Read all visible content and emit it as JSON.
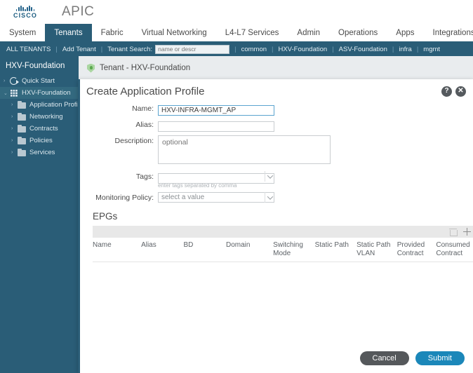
{
  "brand": {
    "logo_name": "cisco-logo",
    "logo_text": "CISCO",
    "product": "APIC"
  },
  "nav": {
    "tabs": [
      {
        "label": "System",
        "active": false
      },
      {
        "label": "Tenants",
        "active": true
      },
      {
        "label": "Fabric",
        "active": false
      },
      {
        "label": "Virtual Networking",
        "active": false
      },
      {
        "label": "L4-L7 Services",
        "active": false
      },
      {
        "label": "Admin",
        "active": false
      },
      {
        "label": "Operations",
        "active": false
      },
      {
        "label": "Apps",
        "active": false
      },
      {
        "label": "Integrations",
        "active": false
      }
    ]
  },
  "tenant_bar": {
    "all_tenants": "ALL TENANTS",
    "add_tenant": "Add Tenant",
    "search_label": "Tenant Search:",
    "search_placeholder": "name or descr",
    "search_value": "",
    "links": [
      "common",
      "HXV-Foundation",
      "ASV-Foundation",
      "infra",
      "mgmt"
    ],
    "separator": "|"
  },
  "sidebar": {
    "title": "HXV-Foundation",
    "tools": [
      "collapse-icon",
      "navigate-icon",
      "history-icon"
    ],
    "tree": [
      {
        "label": "Quick Start",
        "icon": "quick-start-icon",
        "indent": false,
        "selected": false
      },
      {
        "label": "HXV-Foundation",
        "icon": "tenant-icon",
        "indent": false,
        "selected": true
      },
      {
        "label": "Application Profiles",
        "icon": "folder-icon",
        "indent": true,
        "selected": false
      },
      {
        "label": "Networking",
        "icon": "folder-icon",
        "indent": true,
        "selected": false
      },
      {
        "label": "Contracts",
        "icon": "folder-icon",
        "indent": true,
        "selected": false
      },
      {
        "label": "Policies",
        "icon": "folder-icon",
        "indent": true,
        "selected": false
      },
      {
        "label": "Services",
        "icon": "folder-icon",
        "indent": true,
        "selected": false
      }
    ]
  },
  "breadcrumb": {
    "icon": "tenant-shield-icon",
    "text": "Tenant - HXV-Foundation"
  },
  "dialog": {
    "title": "Create Application Profile",
    "help_icon": "help-icon",
    "help_label": "?",
    "close_icon": "close-icon",
    "close_label": "✕",
    "fields": {
      "name": {
        "label": "Name:",
        "value": "HXV-INFRA-MGMT_AP",
        "placeholder": ""
      },
      "alias": {
        "label": "Alias:",
        "value": "",
        "placeholder": ""
      },
      "description": {
        "label": "Description:",
        "value": "",
        "placeholder": "optional"
      },
      "tags": {
        "label": "Tags:",
        "value": "",
        "placeholder": "",
        "hint": "enter tags separated by comma"
      },
      "monitoring_policy": {
        "label": "Monitoring Policy:",
        "value": "select a value"
      }
    },
    "epgs": {
      "section_title": "EPGs",
      "delete_icon": "trash-icon",
      "add_icon": "plus-icon",
      "columns": [
        "Name",
        "Alias",
        "BD",
        "Domain",
        "Switching Mode",
        "Static Path",
        "Static Path VLAN",
        "Provided Contract",
        "Consumed Contract"
      ],
      "rows": []
    },
    "footer": {
      "cancel": "Cancel",
      "submit": "Submit"
    }
  },
  "colors": {
    "brand_teal": "#2a5d77",
    "accent_blue": "#1b87b9",
    "cancel_gray": "#55585b",
    "focus_blue": "#5ba4cf"
  }
}
